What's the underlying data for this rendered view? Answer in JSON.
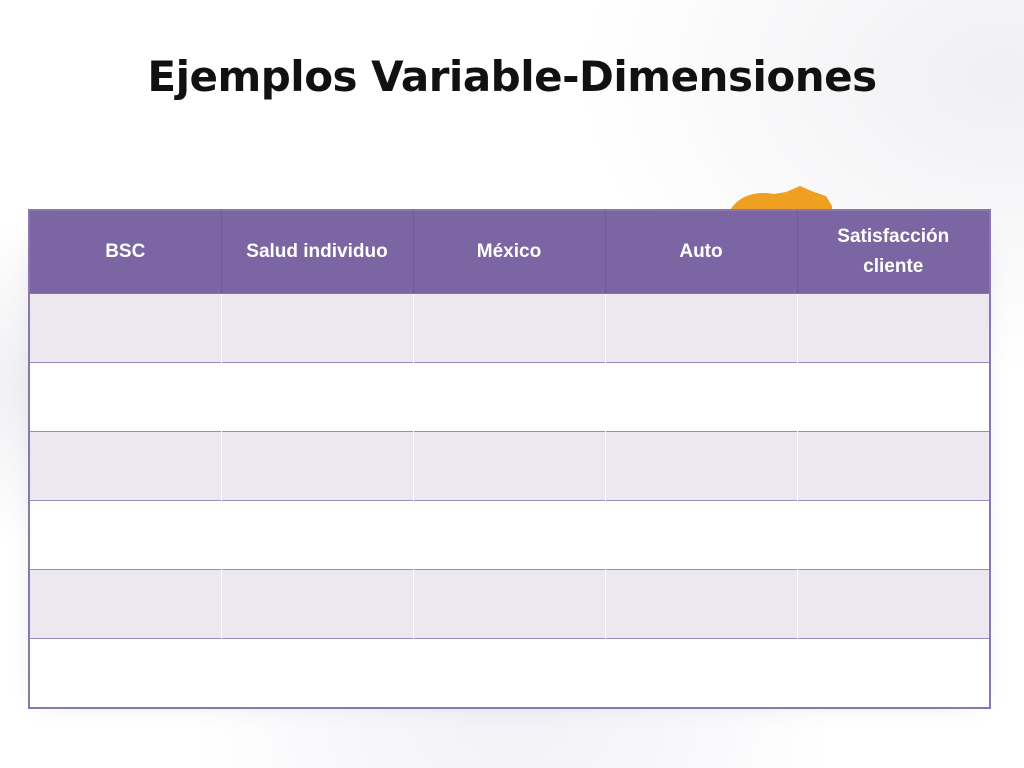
{
  "slide": {
    "title": "Ejemplos Variable-Dimensiones"
  },
  "table": {
    "headers": [
      "BSC",
      "Salud individuo",
      "México",
      "Auto",
      "Satisfacción cliente"
    ],
    "rows": [
      [
        "",
        "",
        "",
        "",
        ""
      ],
      [
        "",
        "",
        "",
        "",
        ""
      ],
      [
        "",
        "",
        "",
        "",
        ""
      ],
      [
        "",
        "",
        "",
        "",
        ""
      ],
      [
        "",
        "",
        "",
        "",
        ""
      ],
      [
        "",
        "",
        "",
        "",
        ""
      ]
    ]
  },
  "colors": {
    "header_bg": "#7b65a3",
    "row_tint": "#ebe8f0",
    "border": "#8a76b0",
    "accent_orange": "#f0a020"
  }
}
